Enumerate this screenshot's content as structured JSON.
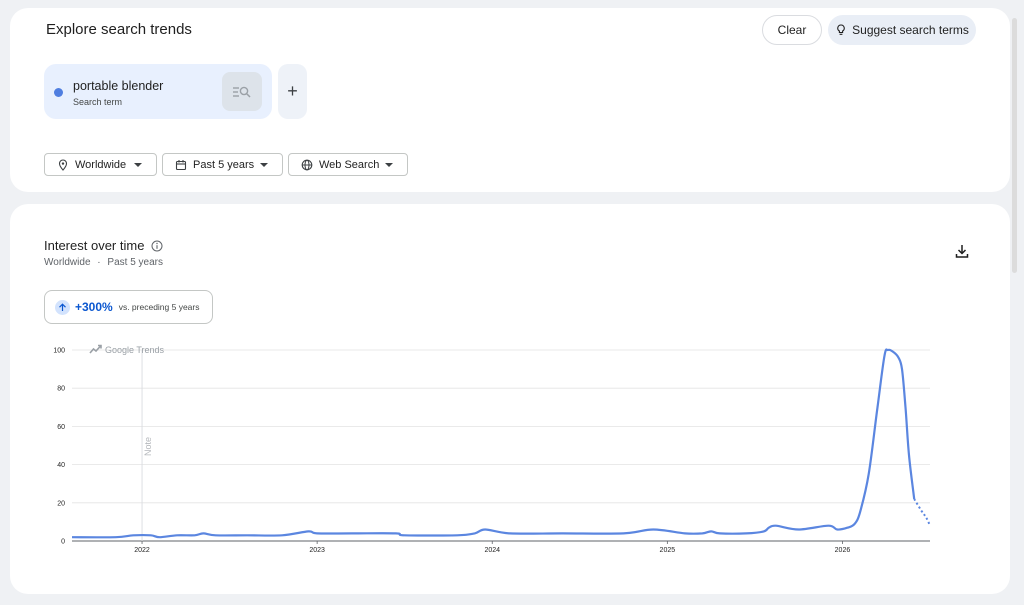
{
  "header": {
    "title": "Explore search trends",
    "clear_label": "Clear",
    "suggest_label": "Suggest search terms"
  },
  "term": {
    "name": "portable blender",
    "type": "Search term",
    "color": "#4f7ee0",
    "add_label": "+"
  },
  "filters": {
    "geo": "Worldwide",
    "time": "Past 5 years",
    "property": "Web Search"
  },
  "interest": {
    "title": "Interest over time",
    "geo": "Worldwide",
    "separator": "·",
    "time": "Past 5 years",
    "change_value": "+300%",
    "change_text": "vs. preceding 5 years",
    "watermark": "Google Trends",
    "note_label": "Note"
  },
  "chart_data": {
    "type": "line",
    "ylim": [
      0,
      100
    ],
    "y_ticks": [
      0,
      20,
      40,
      60,
      80,
      100
    ],
    "x_ticks": [
      "2022",
      "2023",
      "2024",
      "2025",
      "2026"
    ],
    "x_tick_years": [
      2022,
      2023,
      2024,
      2025,
      2026
    ],
    "xlim": [
      2021.6,
      2026.5
    ],
    "grid": true,
    "color": "#5b86e0",
    "note_at": 2022,
    "partial_from": 2026.41,
    "points": [
      [
        2021.6,
        2
      ],
      [
        2021.85,
        2
      ],
      [
        2021.95,
        3
      ],
      [
        2022.05,
        3
      ],
      [
        2022.1,
        2
      ],
      [
        2022.2,
        3
      ],
      [
        2022.3,
        3
      ],
      [
        2022.35,
        4
      ],
      [
        2022.42,
        3
      ],
      [
        2022.6,
        3
      ],
      [
        2022.8,
        3
      ],
      [
        2022.95,
        5
      ],
      [
        2023.0,
        4
      ],
      [
        2023.2,
        4
      ],
      [
        2023.45,
        4
      ],
      [
        2023.5,
        3
      ],
      [
        2023.8,
        3
      ],
      [
        2023.9,
        4
      ],
      [
        2023.96,
        6
      ],
      [
        2024.1,
        4
      ],
      [
        2024.4,
        4
      ],
      [
        2024.75,
        4
      ],
      [
        2024.92,
        6
      ],
      [
        2025.1,
        4
      ],
      [
        2025.2,
        4
      ],
      [
        2025.25,
        5
      ],
      [
        2025.3,
        4
      ],
      [
        2025.45,
        4
      ],
      [
        2025.55,
        5
      ],
      [
        2025.58,
        7
      ],
      [
        2025.62,
        8
      ],
      [
        2025.75,
        6
      ],
      [
        2025.92,
        8
      ],
      [
        2025.97,
        6
      ],
      [
        2026.03,
        7
      ],
      [
        2026.07,
        9
      ],
      [
        2026.1,
        15
      ],
      [
        2026.15,
        35
      ],
      [
        2026.2,
        70
      ],
      [
        2026.24,
        97
      ],
      [
        2026.26,
        100
      ],
      [
        2026.29,
        99
      ],
      [
        2026.32,
        96
      ],
      [
        2026.34,
        90
      ],
      [
        2026.36,
        70
      ],
      [
        2026.38,
        45
      ],
      [
        2026.41,
        22
      ],
      [
        2026.45,
        16
      ],
      [
        2026.48,
        12
      ],
      [
        2026.5,
        8
      ]
    ]
  }
}
